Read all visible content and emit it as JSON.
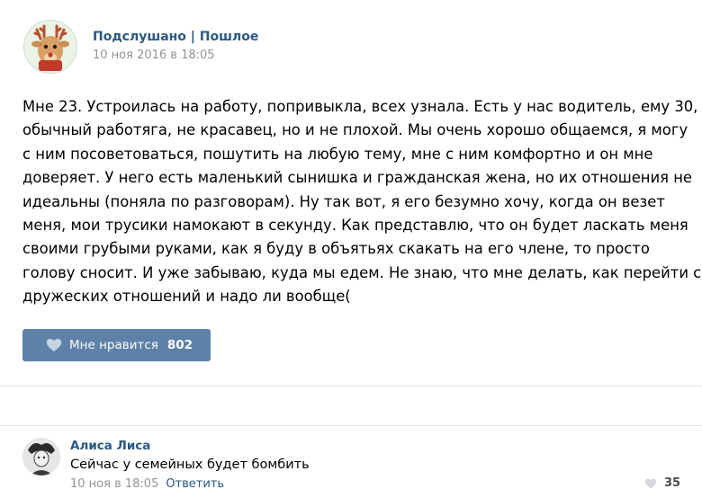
{
  "post": {
    "group_name": "Подслушано | Пошлое",
    "date": "10 ноя 2016 в 18:05",
    "text_lines": [
      "Мне 23. Устроилась на работу, попривыкла, всех узнала. Есть у нас водитель, ему 30,",
      "обычный работяга, не красавец, но и не плохой. Мы очень хорошо общаемся, я могу",
      "с ним посоветоваться, пошутить на любую тему, мне с ним комфортно и он мне",
      "доверяет. У него есть маленький сынишка и гражданская жена, но их отношения не",
      "идеальны (поняла по разговорам). Ну так вот, я его безумно хочу, когда он везет",
      "меня, мои трусики намокают в секунду. Как представлю, что он будет ласкать меня",
      "своими грубыми руками, как я буду в объятьях скакать на его члене, то просто",
      "голову сносит. И уже забываю, куда мы едем. Не знаю, что мне делать, как перейти с",
      "дружеских отношений и надо ли вообще("
    ],
    "like_label": "Мне нравится",
    "like_count": "802"
  },
  "comment": {
    "author": "Алиса Лиса",
    "text": "Сейчас у семейных будет бомбить",
    "date": "10 ноя в 18:05",
    "reply_label": "Ответить",
    "like_count": "35"
  },
  "icons": {
    "group_avatar": "reindeer-avatar-icon",
    "comment_avatar": "user-avatar-icon",
    "like": "heart-icon"
  },
  "colors": {
    "link": "#2a5885",
    "like_button": "#5e81a8",
    "meta": "#939393",
    "divider": "#e3e5e8"
  }
}
